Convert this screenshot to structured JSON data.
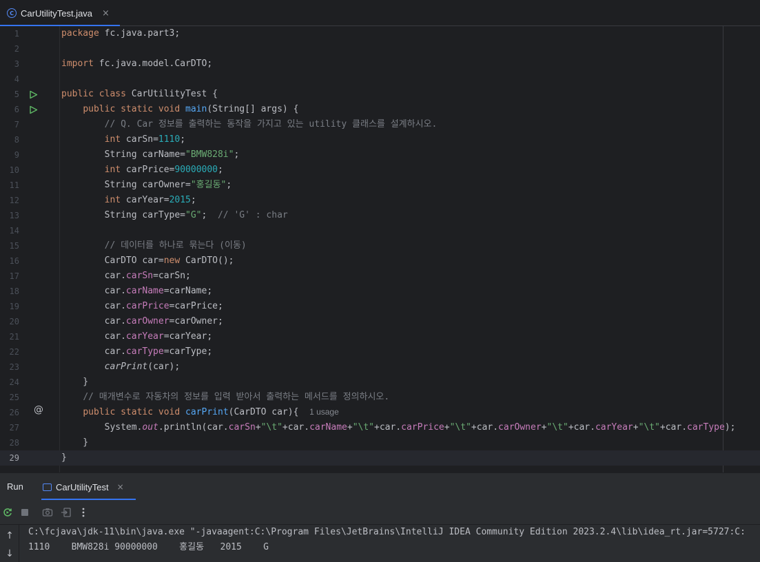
{
  "editor_tab": {
    "label": "CarUtilityTest.java",
    "icon": "java-class-icon",
    "close": "×"
  },
  "code_lines": [
    {
      "n": "1",
      "html": "<span class=\"kw\">package</span> fc.java.part3;"
    },
    {
      "n": "2",
      "html": ""
    },
    {
      "n": "3",
      "html": "<span class=\"kw\">import</span> fc.java.model.CarDTO;"
    },
    {
      "n": "4",
      "html": ""
    },
    {
      "n": "5",
      "html": "<span class=\"kw\">public class</span> CarUtilityTest {",
      "gutter": "run"
    },
    {
      "n": "6",
      "html": "    <span class=\"kw\">public static void</span> <span class=\"fn\">main</span>(String[] args) {",
      "gutter": "run"
    },
    {
      "n": "7",
      "html": "        <span class=\"cmt\">// Q. Car 정보를 출력하는 동작을 가지고 있는 utility 클래스를 설계하시오.</span>"
    },
    {
      "n": "8",
      "html": "        <span class=\"kw\">int</span> carSn=<span class=\"num\">1110</span>;"
    },
    {
      "n": "9",
      "html": "        String carName=<span class=\"str\">\"BMW828i\"</span>;"
    },
    {
      "n": "10",
      "html": "        <span class=\"kw\">int</span> carPrice=<span class=\"num\">90000000</span>;"
    },
    {
      "n": "11",
      "html": "        String carOwner=<span class=\"str\">\"홍길동\"</span>;"
    },
    {
      "n": "12",
      "html": "        <span class=\"kw\">int</span> carYear=<span class=\"num\">2015</span>;"
    },
    {
      "n": "13",
      "html": "        String carType=<span class=\"str\">\"G\"</span>;  <span class=\"cmt\">// 'G' : char</span>"
    },
    {
      "n": "14",
      "html": ""
    },
    {
      "n": "15",
      "html": "        <span class=\"cmt\">// 데이터를 하나로 묶는다 (이동)</span>"
    },
    {
      "n": "16",
      "html": "        CarDTO car=<span class=\"kw\">new</span> CarDTO();"
    },
    {
      "n": "17",
      "html": "        car.<span class=\"fld\">carSn</span>=carSn;"
    },
    {
      "n": "18",
      "html": "        car.<span class=\"fld\">carName</span>=carName;"
    },
    {
      "n": "19",
      "html": "        car.<span class=\"fld\">carPrice</span>=carPrice;"
    },
    {
      "n": "20",
      "html": "        car.<span class=\"fld\">carOwner</span>=carOwner;"
    },
    {
      "n": "21",
      "html": "        car.<span class=\"fld\">carYear</span>=carYear;"
    },
    {
      "n": "22",
      "html": "        car.<span class=\"fld\">carType</span>=carType;"
    },
    {
      "n": "23",
      "html": "        <span class=\"ital\">carPrint</span>(car);"
    },
    {
      "n": "24",
      "html": "    }"
    },
    {
      "n": "25",
      "html": "    <span class=\"cmt\">// 매개변수로 자동차의 정보를 입력 받아서 출력하는 메서드를 정의하시오.</span>"
    },
    {
      "n": "26",
      "html": "    <span class=\"kw\">public static void</span> <span class=\"fn\">carPrint</span>(CarDTO car){  <span class=\"hint\">1 usage</span>",
      "gutter": "at"
    },
    {
      "n": "27",
      "html": "        System.<span class=\"fld ital\">out</span>.println(car.<span class=\"fld\">carSn</span>+<span class=\"str\">\"\\t\"</span>+car.<span class=\"fld\">carName</span>+<span class=\"str\">\"\\t\"</span>+car.<span class=\"fld\">carPrice</span>+<span class=\"str\">\"\\t\"</span>+car.<span class=\"fld\">carOwner</span>+<span class=\"str\">\"\\t\"</span>+car.<span class=\"fld\">carYear</span>+<span class=\"str\">\"\\t\"</span>+car.<span class=\"fld\">carType</span>);"
    },
    {
      "n": "28",
      "html": "    }"
    },
    {
      "n": "29",
      "html": "}",
      "current": true
    }
  ],
  "run_panel": {
    "title": "Run",
    "tab_label": "CarUtilityTest",
    "tab_close": "×",
    "toolbar": [
      "rerun-icon",
      "stop-icon",
      "camera-icon",
      "exit-icon",
      "more-icon"
    ],
    "console": [
      "C:\\fcjava\\jdk-11\\bin\\java.exe \"-javaagent:C:\\Program Files\\JetBrains\\IntelliJ IDEA Community Edition 2023.2.4\\lib\\idea_rt.jar=5727:C:",
      "1110    BMW828i 90000000    홍길동   2015    G"
    ]
  }
}
